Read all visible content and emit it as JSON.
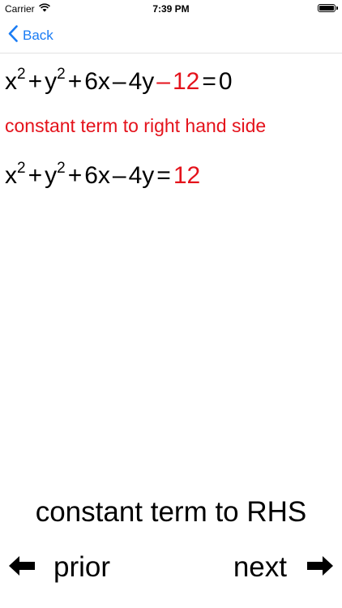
{
  "status_bar": {
    "carrier": "Carrier",
    "time": "7:39 PM"
  },
  "nav": {
    "back_label": "Back"
  },
  "equation1": {
    "t1": "x",
    "t1_exp": "2",
    "op1": "+",
    "t2": "y",
    "t2_exp": "2",
    "op2": "+",
    "t3": "6x",
    "op3": "–",
    "t4": "4y",
    "op4": "–",
    "t5": "12",
    "eq": "=",
    "rhs": "0"
  },
  "hint": "constant term to right hand side",
  "equation2": {
    "t1": "x",
    "t1_exp": "2",
    "op1": "+",
    "t2": "y",
    "t2_exp": "2",
    "op2": "+",
    "t3": "6x",
    "op3": "–",
    "t4": "4y",
    "eq": "=",
    "rhs": "12"
  },
  "caption": "constant term to RHS",
  "bottom_nav": {
    "prior_label": "prior",
    "next_label": "next"
  },
  "colors": {
    "accent_blue": "#1a7cf4",
    "highlight_red": "#e4121b"
  }
}
